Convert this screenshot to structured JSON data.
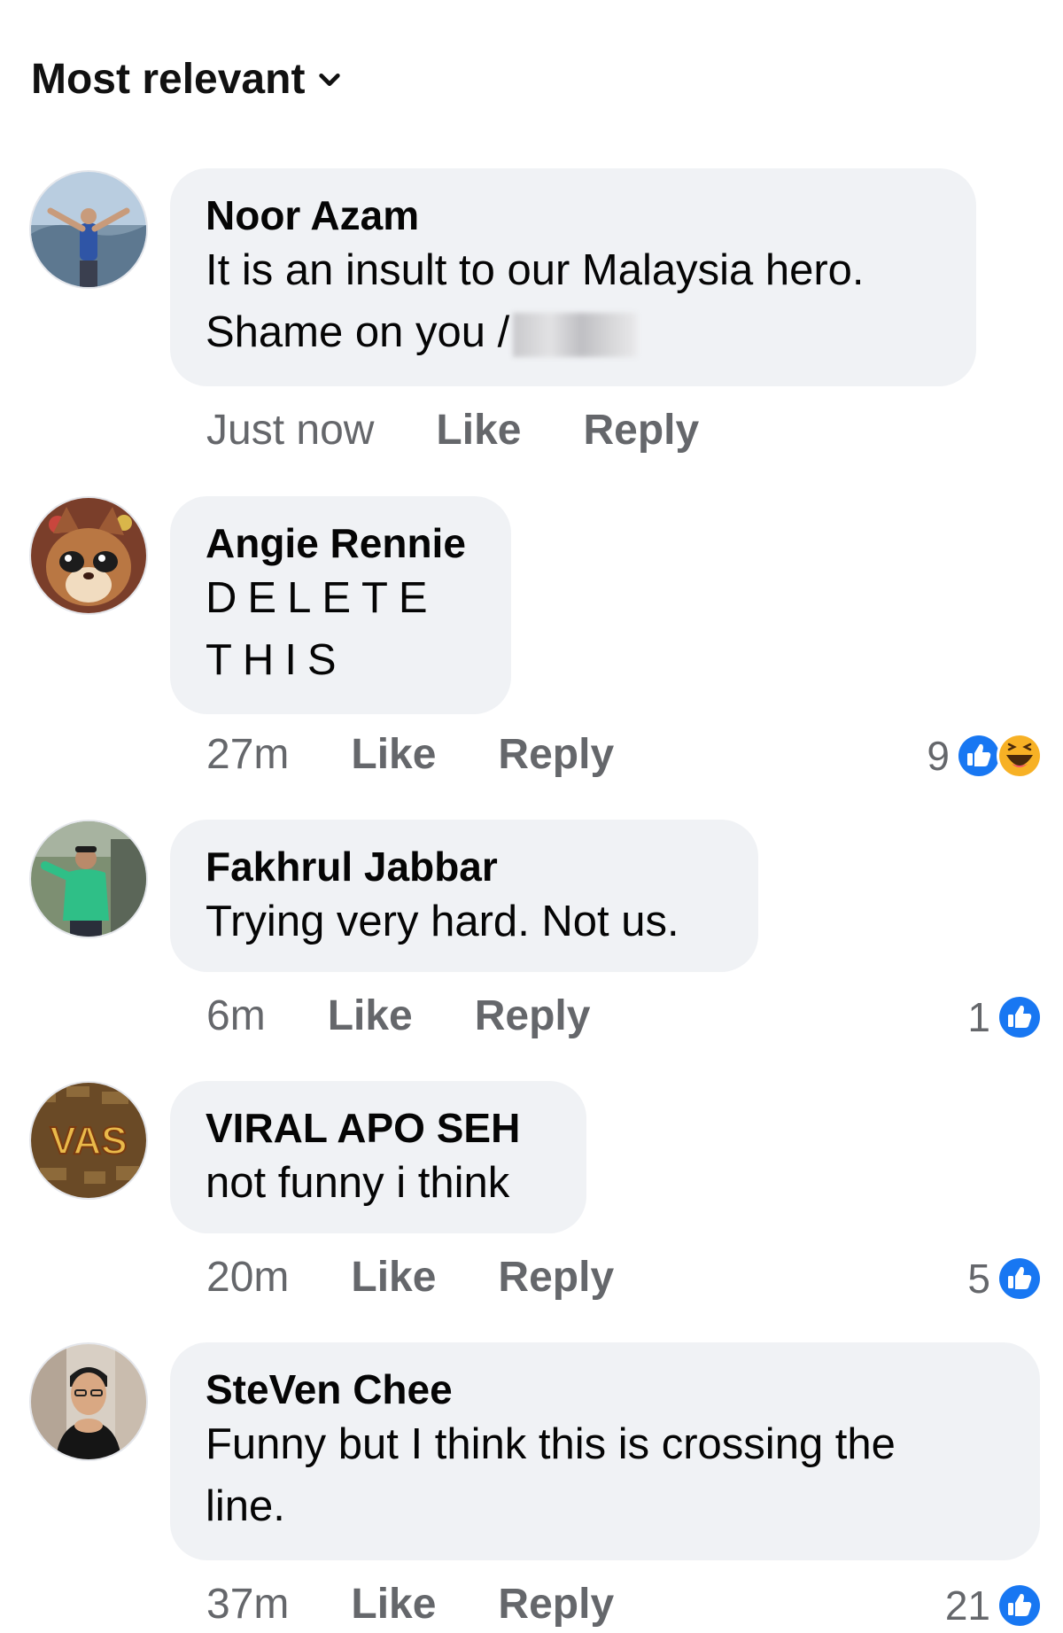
{
  "sort": {
    "label": "Most relevant",
    "icon": "chevron-down-icon"
  },
  "colors": {
    "bubble_bg": "#f0f2f5",
    "meta_text": "#65676b",
    "like_blue": "#1877f2",
    "haha_yellow": "#f7b125"
  },
  "comments": [
    {
      "author": "Noor Azam",
      "text_lines": [
        "It is an insult to our Malaysia hero.",
        "Shame on you /"
      ],
      "time": "Just now",
      "like_label": "Like",
      "reply_label": "Reply",
      "reaction_count": "",
      "reactions": []
    },
    {
      "author": "Angie Rennie",
      "text_lines": [
        "DELETE",
        "THIS"
      ],
      "time": "27m",
      "like_label": "Like",
      "reply_label": "Reply",
      "reaction_count": "9",
      "reactions": [
        "like-icon",
        "haha-icon"
      ]
    },
    {
      "author": "Fakhrul Jabbar",
      "text_lines": [
        "Trying very hard. Not us."
      ],
      "time": "6m",
      "like_label": "Like",
      "reply_label": "Reply",
      "reaction_count": "1",
      "reactions": [
        "like-icon"
      ]
    },
    {
      "author": "VIRAL APO SEH",
      "text_lines": [
        "not funny i think"
      ],
      "time": "20m",
      "like_label": "Like",
      "reply_label": "Reply",
      "reaction_count": "5",
      "reactions": [
        "like-icon"
      ]
    },
    {
      "author": "SteVen Chee",
      "text_lines": [
        "Funny but I think this is crossing the",
        "line."
      ],
      "time": "37m",
      "like_label": "Like",
      "reply_label": "Reply",
      "reaction_count": "21",
      "reactions": [
        "like-icon"
      ]
    }
  ],
  "avatars": [
    {
      "icon": "person-landscape-avatar"
    },
    {
      "icon": "cat-avatar",
      "text": ""
    },
    {
      "icon": "person-green-shirt-avatar"
    },
    {
      "icon": "vas-logo-avatar",
      "text": "VAS"
    },
    {
      "icon": "person-portrait-avatar"
    }
  ]
}
